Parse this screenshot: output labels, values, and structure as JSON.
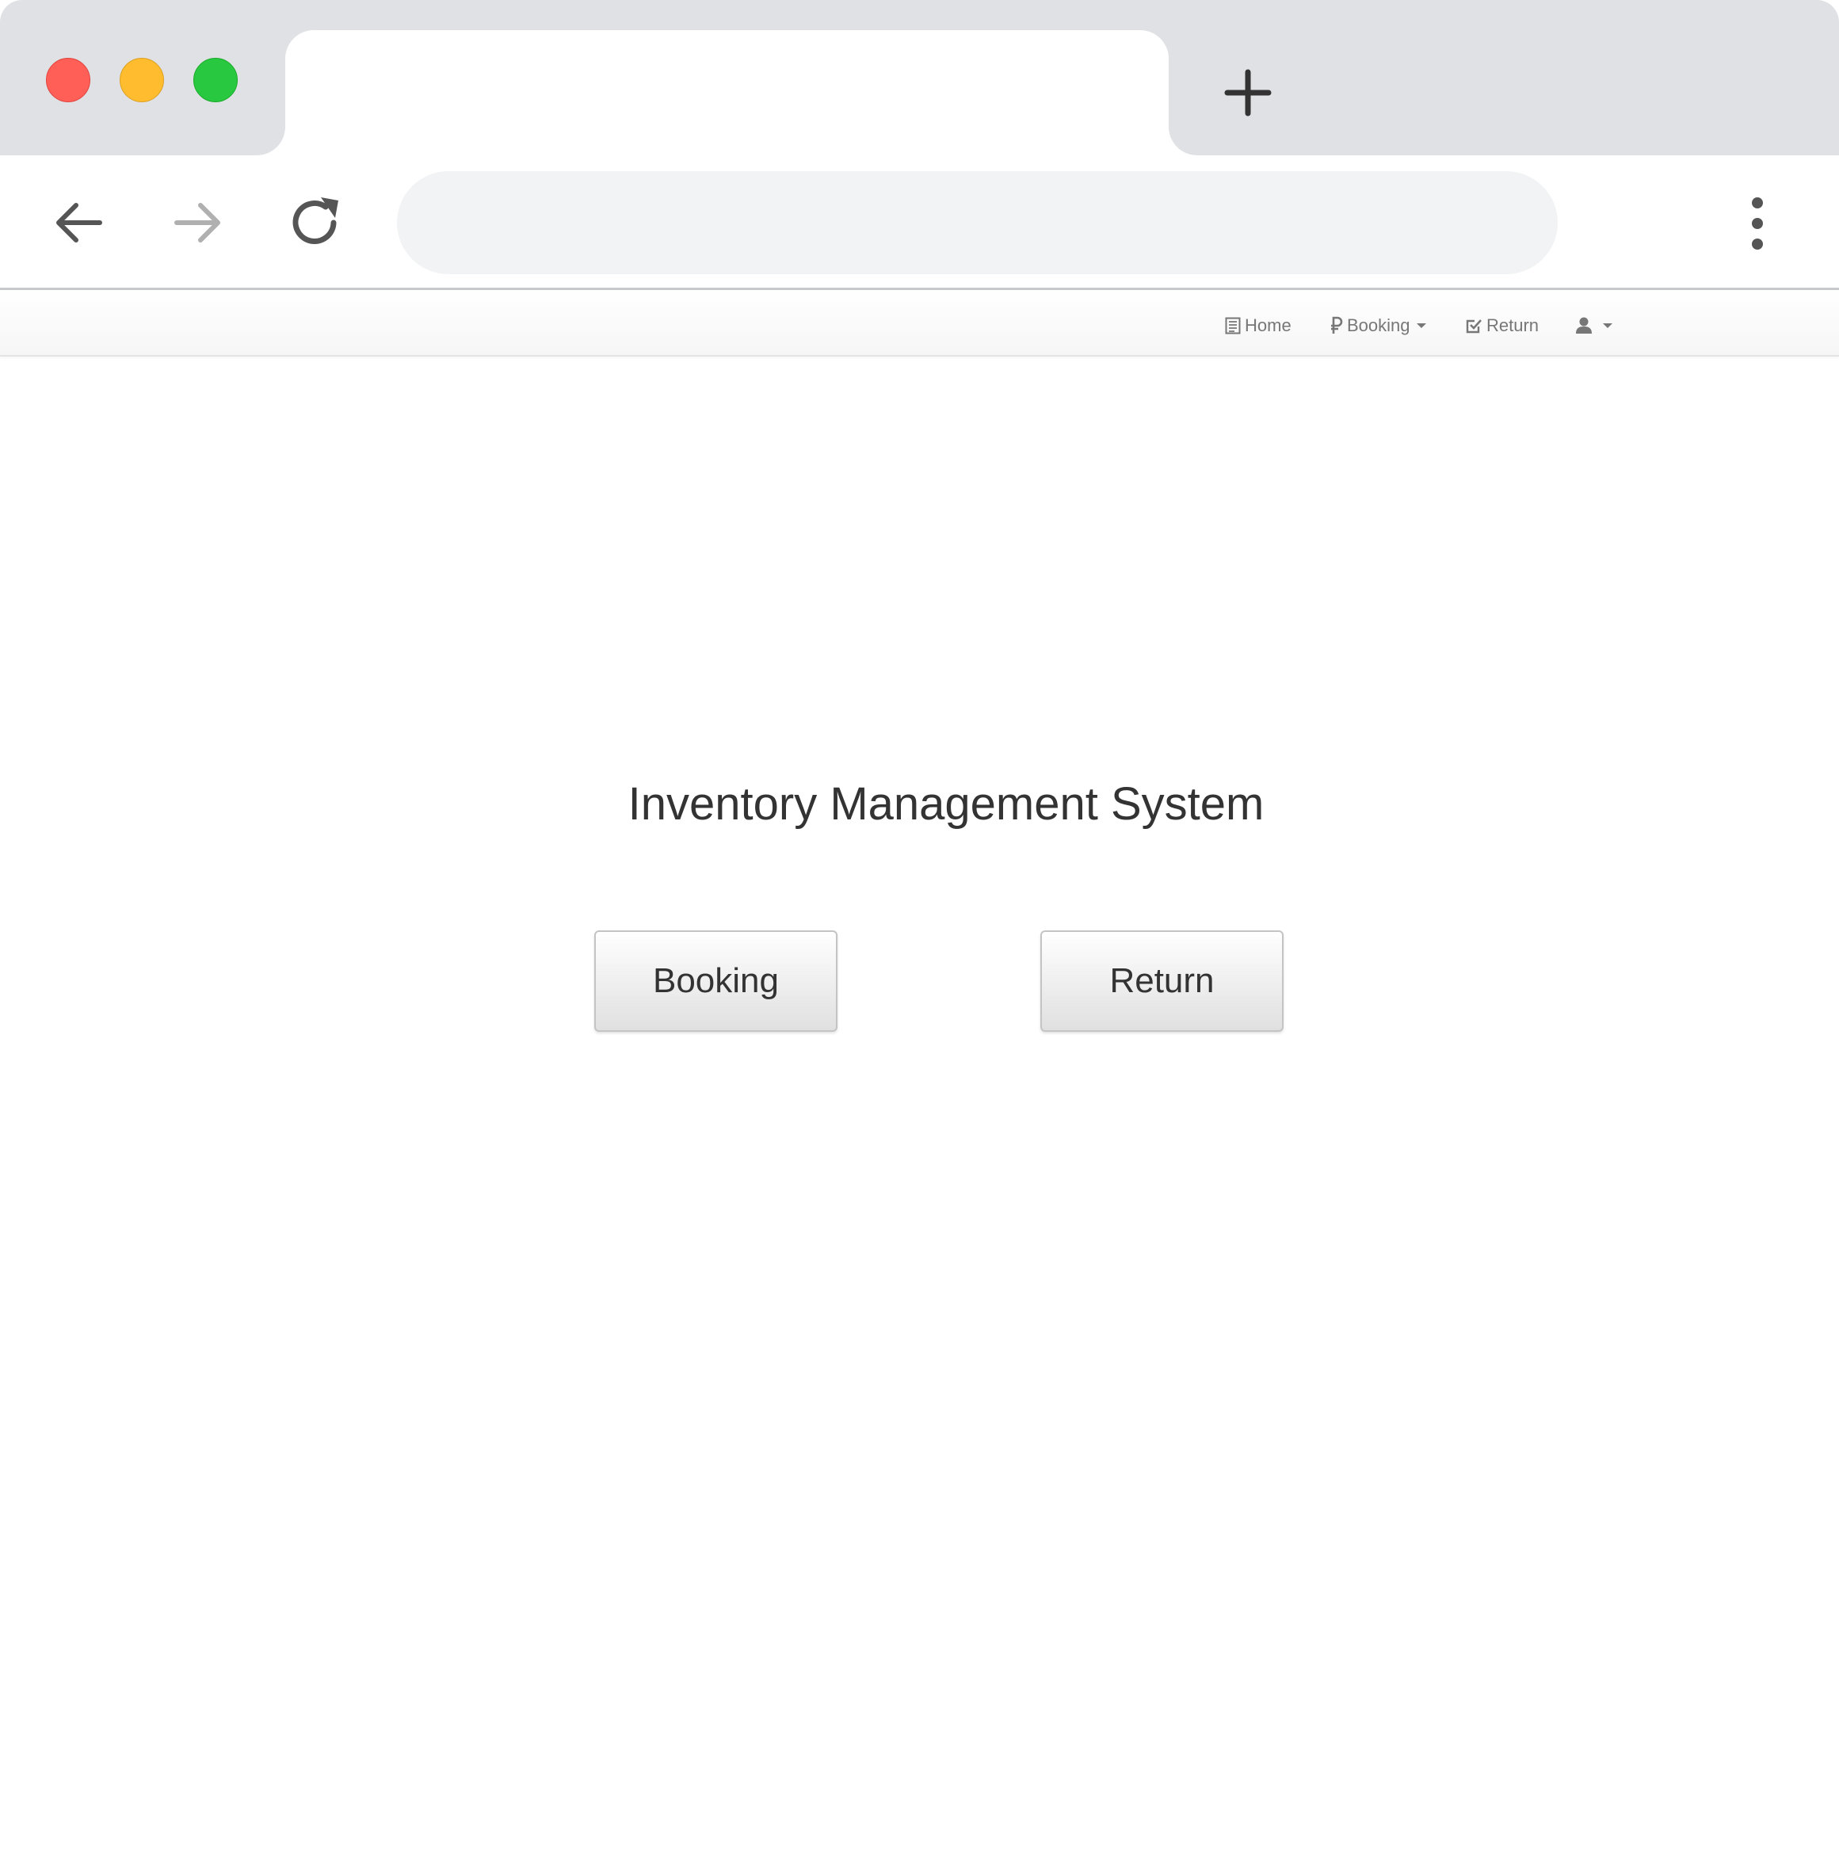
{
  "browser": {
    "tab_title": "",
    "address": "",
    "colors": {
      "close": "#ff5f57",
      "minimize": "#febc2e",
      "maximize": "#28c840",
      "chrome": "#dfe1e5"
    }
  },
  "navbar": {
    "items": [
      {
        "label": "Home",
        "icon": "list-icon"
      },
      {
        "label": "Booking",
        "icon": "ruble-icon",
        "dropdown": true
      },
      {
        "label": "Return",
        "icon": "check-square-icon"
      },
      {
        "label": "",
        "icon": "user-icon",
        "dropdown": true
      }
    ]
  },
  "main": {
    "title": "Inventory Management System",
    "buttons": {
      "booking": "Booking",
      "return": "Return"
    }
  }
}
